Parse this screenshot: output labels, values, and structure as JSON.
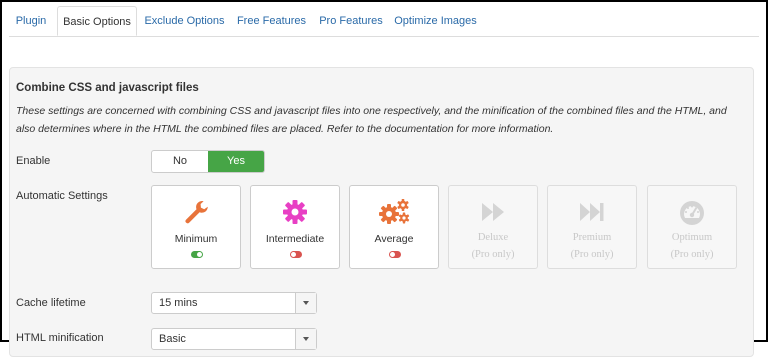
{
  "tabs": [
    "Plugin",
    "Basic Options",
    "Exclude Options",
    "Free Features",
    "Pro Features",
    "Optimize Images"
  ],
  "active_tab": "Basic Options",
  "section": {
    "title": "Combine CSS and javascript files",
    "description": "These settings are concerned with combining CSS and javascript files into one respectively, and the minification of the combined files and the HTML, and also determines where in the HTML the combined files are placed. Refer to the documentation for more information."
  },
  "enable": {
    "label": "Enable",
    "no": "No",
    "yes": "Yes",
    "value": "Yes"
  },
  "auto": {
    "label": "Automatic Settings",
    "cards": [
      {
        "name": "Minimum",
        "icon": "wrench-icon",
        "color": "#e8733a",
        "state": "on"
      },
      {
        "name": "Intermediate",
        "icon": "gear-icon",
        "color": "#e83fc4",
        "state": "off"
      },
      {
        "name": "Average",
        "icon": "gears-icon",
        "color": "#e8733a",
        "state": "off"
      },
      {
        "name": "Deluxe",
        "icon": "fast-forward-icon",
        "pro": "(Pro only)"
      },
      {
        "name": "Premium",
        "icon": "skip-forward-icon",
        "pro": "(Pro only)"
      },
      {
        "name": "Optimum",
        "icon": "dashboard-icon",
        "pro": "(Pro only)"
      }
    ]
  },
  "cache": {
    "label": "Cache lifetime",
    "value": "15 mins"
  },
  "html_min": {
    "label": "HTML minification",
    "value": "Basic"
  },
  "colors": {
    "accent_green": "#46a546",
    "switch_off": "#d9534f",
    "tab_link": "#2a6aa8"
  }
}
